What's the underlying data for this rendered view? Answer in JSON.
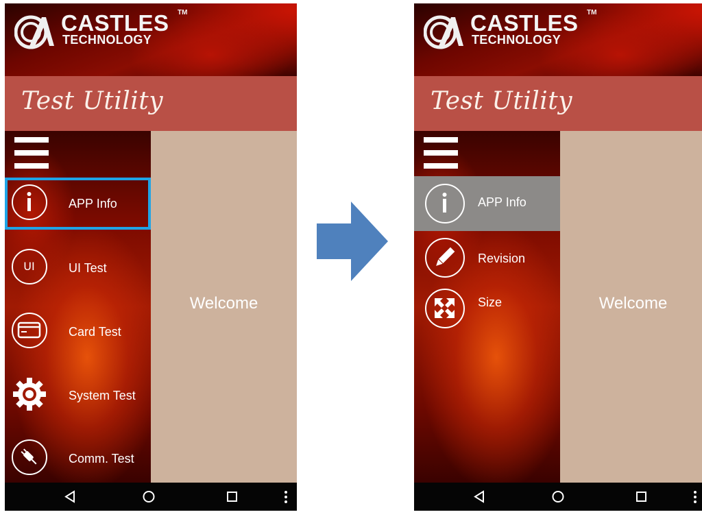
{
  "brand": {
    "name": "CASTLES",
    "tm": "TM",
    "subtitle": "TECHNOLOGY"
  },
  "app_title": "Test Utility",
  "left_screen": {
    "menu_items": [
      {
        "label": "APP Info",
        "icon": "info-icon",
        "selected": true
      },
      {
        "label": "UI Test",
        "icon": "ui-icon",
        "icon_text": "UI"
      },
      {
        "label": "Card Test",
        "icon": "card-icon"
      },
      {
        "label": "System Test",
        "icon": "gear-icon"
      },
      {
        "label": "Comm. Test",
        "icon": "plug-icon"
      }
    ],
    "content_text": "Welcome"
  },
  "right_screen": {
    "menu_items": [
      {
        "label": "APP Info",
        "icon": "info-icon",
        "selected": true
      },
      {
        "label": "Revision",
        "icon": "pencil-icon"
      },
      {
        "label": "Size",
        "icon": "expand-icon"
      }
    ],
    "content_text": "Welcome"
  },
  "colors": {
    "title_bar": "#b95046",
    "content_bg": "#cdb29d",
    "highlight_border": "#1fa4e6",
    "selected_item_bg": "#8c8a88",
    "arrow": "#4f81bd"
  }
}
